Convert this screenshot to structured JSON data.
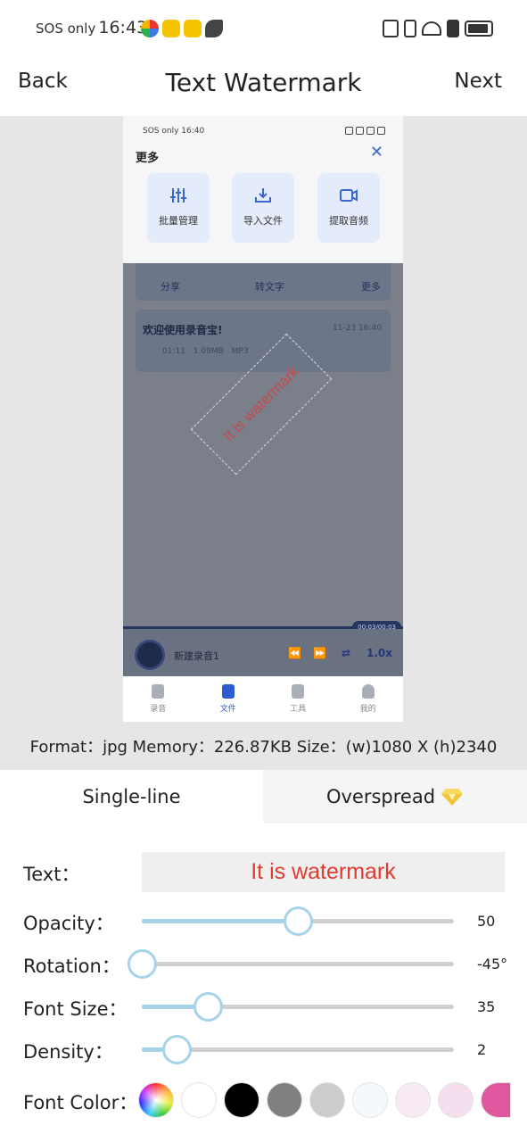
{
  "status_bar": {
    "sos": "SOS only",
    "time": "16:43"
  },
  "header": {
    "back_label": "Back",
    "title": "Text Watermark",
    "next_label": "Next"
  },
  "preview": {
    "status_text": "SOS only 16:40",
    "more_title": "更多",
    "close_glyph": "✕",
    "tiles": [
      "批量管理",
      "导入文件",
      "提取音频"
    ],
    "actions": [
      "分享",
      "转文字",
      "更多"
    ],
    "recording": {
      "title": "欢迎使用录音宝!",
      "date": "11-23 16:40",
      "meta": "01:11 1.09MB MP3"
    },
    "watermark_text": "It is watermark",
    "player": {
      "time": "00:03/00:03",
      "name": "新建录音1",
      "speed": "1.0x"
    },
    "tabs": [
      "录音",
      "文件",
      "工具",
      "我的"
    ]
  },
  "info_line": "Format：jpg Memory：226.87KB Size：(w)1080 X (h)2340",
  "mode_tabs": {
    "single": "Single-line",
    "overspread": "Overspread"
  },
  "controls": {
    "text_label": "Text：",
    "text_value": "It is watermark",
    "opacity": {
      "label": "Opacity：",
      "value": "50",
      "fraction": 0.5
    },
    "rotation": {
      "label": "Rotation：",
      "value": "-45°",
      "fraction": 0.0
    },
    "font_size": {
      "label": "Font Size：",
      "value": "35",
      "fraction": 0.21
    },
    "density": {
      "label": "Density：",
      "value": "2",
      "fraction": 0.11
    },
    "font_color_label": "Font Color："
  },
  "colors": {
    "accent_slider": "#a7d3ea",
    "watermark_red": "#e03b2f",
    "swatches": [
      "rainbow",
      "#ffffff",
      "#000000",
      "#808080",
      "#cccccc",
      "#f5f8fc",
      "#f8eaf4",
      "#f5dfee",
      "#e0589f"
    ]
  }
}
